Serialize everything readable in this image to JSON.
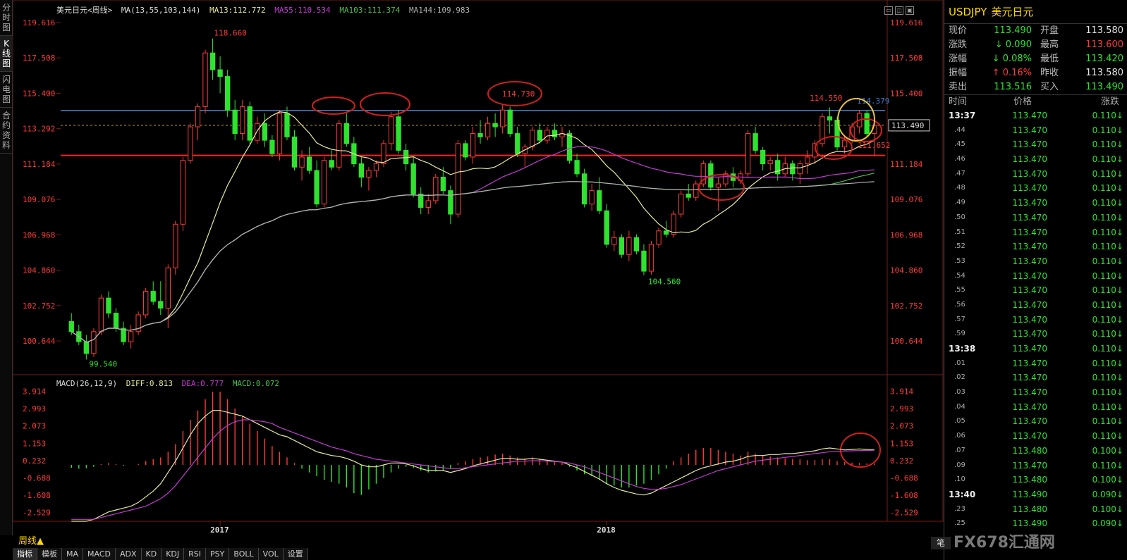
{
  "left_tabs": [
    "分时图",
    "K线图",
    "闪电图",
    "合约资料"
  ],
  "kline_header": {
    "symbol": "美元日元",
    "period": "<周线>",
    "ma_label": "MA(13,55,103,144)",
    "ma13": "MA13:112.772",
    "ma55": "MA55:110.534",
    "ma103": "MA103:111.374",
    "ma144": "MA144:109.983"
  },
  "macd_header": {
    "label": "MACD(26,12,9)",
    "diff": "DIFF:0.813",
    "dea": "DEA:0.777",
    "macd": "MACD:0.072"
  },
  "colors": {
    "up": "#ff3a3a",
    "down": "#2ee32e",
    "ma13": "#e8e8a0",
    "ma55": "#c43ad4",
    "ma103": "#4ec04e",
    "ma144": "#b0b0b0",
    "axis_label": "#ff3a3a",
    "resistance": "#3a7bd5",
    "support": "#ff2020"
  },
  "price_axis": [
    "119.616",
    "117.508",
    "115.400",
    "113.292",
    "111.184",
    "109.076",
    "106.968",
    "104.860",
    "102.752",
    "100.644"
  ],
  "macd_axis": [
    "3.914",
    "2.993",
    "2.073",
    "1.153",
    "0.232",
    "-0.688",
    "-1.608",
    "-2.529"
  ],
  "price_range": [
    98.8,
    120.2
  ],
  "macd_range": [
    -3.3,
    4.2
  ],
  "time_labels": [
    {
      "label": "2017",
      "index": 20
    },
    {
      "label": "2018",
      "index": 72
    }
  ],
  "annotations": {
    "high1": "118.660",
    "low1": "99.540",
    "circle_high": "114.730",
    "low2": "104.560",
    "high2": "114.550",
    "right_high": "114.379",
    "right_low": "111.652",
    "current_price": "113.490"
  },
  "candles": [
    [
      101.8,
      102.3,
      101.0,
      101.2
    ],
    [
      101.2,
      101.6,
      100.4,
      100.6
    ],
    [
      100.6,
      101.0,
      99.54,
      99.9
    ],
    [
      99.9,
      101.4,
      99.7,
      101.2
    ],
    [
      101.2,
      103.4,
      101.0,
      103.2
    ],
    [
      103.2,
      103.6,
      102.0,
      102.3
    ],
    [
      102.3,
      102.6,
      101.2,
      101.4
    ],
    [
      101.4,
      101.8,
      100.4,
      100.6
    ],
    [
      100.6,
      101.6,
      100.2,
      101.2
    ],
    [
      101.2,
      102.4,
      101.0,
      102.2
    ],
    [
      102.2,
      103.8,
      102.0,
      103.6
    ],
    [
      103.6,
      104.2,
      102.8,
      103.0
    ],
    [
      103.0,
      104.2,
      102.2,
      102.6
    ],
    [
      102.6,
      105.2,
      101.4,
      105.0
    ],
    [
      105.0,
      107.8,
      104.6,
      107.6
    ],
    [
      107.6,
      111.6,
      107.2,
      111.4
    ],
    [
      111.4,
      113.6,
      111.2,
      113.4
    ],
    [
      113.4,
      114.8,
      112.6,
      114.6
    ],
    [
      114.6,
      118.0,
      114.2,
      117.8
    ],
    [
      117.8,
      118.66,
      116.2,
      116.8
    ],
    [
      116.8,
      117.6,
      115.4,
      116.4
    ],
    [
      116.4,
      116.8,
      114.0,
      114.4
    ],
    [
      114.4,
      115.0,
      112.6,
      113.0
    ],
    [
      113.0,
      115.0,
      112.6,
      114.6
    ],
    [
      114.6,
      114.9,
      112.4,
      112.6
    ],
    [
      112.6,
      114.0,
      112.4,
      113.6
    ],
    [
      113.6,
      114.2,
      112.2,
      112.6
    ],
    [
      112.6,
      112.9,
      111.6,
      111.8
    ],
    [
      111.8,
      114.4,
      111.4,
      114.2
    ],
    [
      114.2,
      114.6,
      112.6,
      112.8
    ],
    [
      112.8,
      113.2,
      110.8,
      111.0
    ],
    [
      111.0,
      112.0,
      110.2,
      111.6
    ],
    [
      111.6,
      112.2,
      110.6,
      110.8
    ],
    [
      110.8,
      111.4,
      108.6,
      108.8
    ],
    [
      108.8,
      111.6,
      108.6,
      111.4
    ],
    [
      111.4,
      112.0,
      110.8,
      111.0
    ],
    [
      111.0,
      113.8,
      110.8,
      113.6
    ],
    [
      113.6,
      114.2,
      112.2,
      112.4
    ],
    [
      112.4,
      112.8,
      111.0,
      111.2
    ],
    [
      111.2,
      111.6,
      109.8,
      110.4
    ],
    [
      110.4,
      111.0,
      109.6,
      110.8
    ],
    [
      110.8,
      111.4,
      110.4,
      111.2
    ],
    [
      111.2,
      112.6,
      111.0,
      112.4
    ],
    [
      112.4,
      114.3,
      112.0,
      114.0
    ],
    [
      114.0,
      114.4,
      111.8,
      112.0
    ],
    [
      112.0,
      112.4,
      110.8,
      111.2
    ],
    [
      111.2,
      111.6,
      109.2,
      109.4
    ],
    [
      109.4,
      109.8,
      108.2,
      108.6
    ],
    [
      108.6,
      109.4,
      108.2,
      109.0
    ],
    [
      109.0,
      110.6,
      108.8,
      110.4
    ],
    [
      110.4,
      111.0,
      109.4,
      109.6
    ],
    [
      109.6,
      109.9,
      107.6,
      108.2
    ],
    [
      108.2,
      112.6,
      108.0,
      112.4
    ],
    [
      112.4,
      112.6,
      111.4,
      111.6
    ],
    [
      111.6,
      113.4,
      111.2,
      113.0
    ],
    [
      113.0,
      113.8,
      112.4,
      112.8
    ],
    [
      112.8,
      114.0,
      112.6,
      113.6
    ],
    [
      113.6,
      114.2,
      112.8,
      113.4
    ],
    [
      113.4,
      114.73,
      113.0,
      114.4
    ],
    [
      114.4,
      114.6,
      112.8,
      113.0
    ],
    [
      113.0,
      113.4,
      111.6,
      111.8
    ],
    [
      111.8,
      112.4,
      111.0,
      112.2
    ],
    [
      112.2,
      113.4,
      112.0,
      113.2
    ],
    [
      113.2,
      113.6,
      112.4,
      112.6
    ],
    [
      112.6,
      113.4,
      112.4,
      113.2
    ],
    [
      113.2,
      113.6,
      112.6,
      112.8
    ],
    [
      112.8,
      113.4,
      112.2,
      113.0
    ],
    [
      113.0,
      113.2,
      111.2,
      111.4
    ],
    [
      111.4,
      111.8,
      110.4,
      110.6
    ],
    [
      110.6,
      110.9,
      108.6,
      108.8
    ],
    [
      108.8,
      110.0,
      108.4,
      109.6
    ],
    [
      109.6,
      110.4,
      108.2,
      108.4
    ],
    [
      108.4,
      108.8,
      106.2,
      106.4
    ],
    [
      106.4,
      107.2,
      106.0,
      106.8
    ],
    [
      106.8,
      107.0,
      105.6,
      105.8
    ],
    [
      105.8,
      107.2,
      105.4,
      106.8
    ],
    [
      106.8,
      107.0,
      105.8,
      106.0
    ],
    [
      106.0,
      106.4,
      104.56,
      104.8
    ],
    [
      104.8,
      106.6,
      104.6,
      106.4
    ],
    [
      106.4,
      107.4,
      106.2,
      107.2
    ],
    [
      107.2,
      107.8,
      106.8,
      107.0
    ],
    [
      107.0,
      108.4,
      106.8,
      108.2
    ],
    [
      108.2,
      109.6,
      108.0,
      109.4
    ],
    [
      109.4,
      110.0,
      109.0,
      109.2
    ],
    [
      109.2,
      110.2,
      109.0,
      110.0
    ],
    [
      110.0,
      111.4,
      109.8,
      111.2
    ],
    [
      111.2,
      111.4,
      109.6,
      109.8
    ],
    [
      109.8,
      110.4,
      108.4,
      110.0
    ],
    [
      110.0,
      110.8,
      109.8,
      110.6
    ],
    [
      110.6,
      111.0,
      109.8,
      110.2
    ],
    [
      110.2,
      110.8,
      110.0,
      110.6
    ],
    [
      110.6,
      113.2,
      110.4,
      113.0
    ],
    [
      113.0,
      113.4,
      111.8,
      112.0
    ],
    [
      112.0,
      112.2,
      110.8,
      111.2
    ],
    [
      111.2,
      111.6,
      110.8,
      111.4
    ],
    [
      111.4,
      111.8,
      110.2,
      110.6
    ],
    [
      110.6,
      111.6,
      110.4,
      111.2
    ],
    [
      111.2,
      111.4,
      110.2,
      110.6
    ],
    [
      110.6,
      111.4,
      110.0,
      111.2
    ],
    [
      111.2,
      112.0,
      110.6,
      111.6
    ],
    [
      111.6,
      112.6,
      111.2,
      112.4
    ],
    [
      112.4,
      114.2,
      112.2,
      114.0
    ],
    [
      114.0,
      114.55,
      113.0,
      113.8
    ],
    [
      113.8,
      114.0,
      112.0,
      112.2
    ],
    [
      112.2,
      112.9,
      111.8,
      112.6
    ],
    [
      112.6,
      113.6,
      112.4,
      113.4
    ],
    [
      113.4,
      114.4,
      113.0,
      114.2
    ],
    [
      114.2,
      114.379,
      112.8,
      113.0
    ],
    [
      113.0,
      113.6,
      111.652,
      113.49
    ]
  ],
  "macd_hist": [
    -0.15,
    -0.2,
    -0.18,
    -0.1,
    0.05,
    0.1,
    0.05,
    -0.05,
    0.0,
    0.05,
    0.2,
    0.3,
    0.4,
    0.7,
    1.1,
    1.8,
    2.4,
    2.9,
    3.5,
    3.9,
    3.9,
    3.5,
    3.0,
    2.6,
    2.2,
    1.8,
    1.4,
    1.0,
    0.7,
    0.4,
    0.1,
    -0.2,
    -0.4,
    -0.6,
    -0.8,
    -0.9,
    -1.0,
    -1.2,
    -1.5,
    -1.6,
    -1.3,
    -1.0,
    -0.7,
    -0.4,
    -0.2,
    -0.1,
    -0.15,
    -0.3,
    -0.4,
    -0.35,
    -0.3,
    -0.2,
    0.1,
    0.2,
    0.3,
    0.4,
    0.45,
    0.55,
    0.6,
    0.5,
    0.4,
    0.35,
    0.4,
    0.3,
    0.25,
    0.2,
    0.15,
    -0.1,
    -0.3,
    -0.5,
    -0.6,
    -0.8,
    -1.0,
    -1.1,
    -1.2,
    -1.2,
    -1.1,
    -1.0,
    -0.8,
    -0.5,
    -0.2,
    0.2,
    0.4,
    0.6,
    0.8,
    0.9,
    0.9,
    0.8,
    0.7,
    0.6,
    0.5,
    0.7,
    0.6,
    0.5,
    0.45,
    0.4,
    0.35,
    0.3,
    0.3,
    0.25,
    0.25,
    0.3,
    0.3,
    0.2,
    0.15,
    0.12,
    0.1,
    0.08,
    0.07
  ],
  "diff_line": [
    -3.0,
    -3.0,
    -3.0,
    -2.9,
    -2.7,
    -2.5,
    -2.4,
    -2.3,
    -2.2,
    -2.0,
    -1.7,
    -1.4,
    -1.0,
    -0.4,
    0.2,
    0.9,
    1.6,
    2.2,
    2.6,
    2.9,
    2.9,
    2.8,
    2.7,
    2.6,
    2.4,
    2.2,
    2.0,
    1.8,
    1.6,
    1.5,
    1.3,
    1.1,
    0.9,
    0.7,
    0.6,
    0.5,
    0.45,
    0.35,
    0.2,
    0.0,
    -0.1,
    -0.1,
    0.0,
    0.1,
    0.1,
    0.05,
    -0.05,
    -0.2,
    -0.3,
    -0.3,
    -0.3,
    -0.4,
    -0.3,
    -0.2,
    -0.05,
    0.05,
    0.15,
    0.25,
    0.35,
    0.35,
    0.3,
    0.3,
    0.35,
    0.3,
    0.25,
    0.2,
    0.15,
    0.0,
    -0.15,
    -0.35,
    -0.55,
    -0.75,
    -1.0,
    -1.2,
    -1.35,
    -1.45,
    -1.55,
    -1.6,
    -1.5,
    -1.3,
    -1.1,
    -0.9,
    -0.7,
    -0.5,
    -0.3,
    -0.15,
    -0.05,
    0.05,
    0.15,
    0.2,
    0.3,
    0.45,
    0.5,
    0.5,
    0.55,
    0.55,
    0.6,
    0.6,
    0.65,
    0.7,
    0.75,
    0.85,
    0.9,
    0.85,
    0.8,
    0.82,
    0.85,
    0.82,
    0.813
  ],
  "dea_line": [
    -2.9,
    -2.9,
    -2.9,
    -2.9,
    -2.8,
    -2.7,
    -2.6,
    -2.5,
    -2.4,
    -2.3,
    -2.2,
    -2.0,
    -1.8,
    -1.5,
    -1.1,
    -0.6,
    -0.1,
    0.4,
    0.9,
    1.4,
    1.8,
    2.1,
    2.3,
    2.4,
    2.4,
    2.35,
    2.3,
    2.2,
    2.0,
    1.85,
    1.7,
    1.55,
    1.4,
    1.25,
    1.1,
    0.95,
    0.85,
    0.75,
    0.6,
    0.5,
    0.4,
    0.3,
    0.25,
    0.2,
    0.15,
    0.1,
    0.05,
    0.0,
    -0.05,
    -0.1,
    -0.15,
    -0.2,
    -0.2,
    -0.15,
    -0.1,
    -0.05,
    0.0,
    0.05,
    0.1,
    0.15,
    0.2,
    0.2,
    0.22,
    0.22,
    0.2,
    0.18,
    0.15,
    0.1,
    0.0,
    -0.1,
    -0.25,
    -0.4,
    -0.55,
    -0.7,
    -0.85,
    -1.0,
    -1.15,
    -1.25,
    -1.3,
    -1.3,
    -1.25,
    -1.15,
    -1.05,
    -0.9,
    -0.75,
    -0.6,
    -0.45,
    -0.3,
    -0.2,
    -0.1,
    0.0,
    0.1,
    0.2,
    0.25,
    0.3,
    0.35,
    0.4,
    0.45,
    0.5,
    0.55,
    0.6,
    0.65,
    0.7,
    0.72,
    0.74,
    0.75,
    0.76,
    0.77,
    0.777
  ],
  "quote": {
    "symbol": "USDJPY",
    "name": "美元日元",
    "rows": [
      {
        "l1": "现价",
        "v1": "113.490",
        "c1": "green",
        "l2": "开盘",
        "v2": "113.580",
        "c2": "white"
      },
      {
        "l1": "涨跌",
        "v1": "↓ 0.090",
        "c1": "green",
        "l2": "最高",
        "v2": "113.600",
        "c2": "red"
      },
      {
        "l1": "涨幅",
        "v1": "↓ 0.08%",
        "c1": "green",
        "l2": "最低",
        "v2": "113.420",
        "c2": "green"
      },
      {
        "l1": "振幅",
        "v1": "↑ 0.16%",
        "c1": "red",
        "l2": "昨收",
        "v2": "113.580",
        "c2": "white"
      },
      {
        "l1": "卖出",
        "v1": "113.516",
        "c1": "green",
        "l2": "买入",
        "v2": "113.490",
        "c2": "green"
      }
    ],
    "table_headers": [
      "时间",
      "价格",
      "涨跌"
    ],
    "ticks": [
      {
        "t": "13:37",
        "major": true,
        "p": "113.470",
        "c": "0.110↓"
      },
      {
        "t": ".44",
        "p": "113.470",
        "c": "0.110↓"
      },
      {
        "t": ".45",
        "p": "113.470",
        "c": "0.110↓"
      },
      {
        "t": ".46",
        "p": "113.470",
        "c": "0.110↓"
      },
      {
        "t": ".47",
        "p": "113.470",
        "c": "0.110↓"
      },
      {
        "t": ".48",
        "p": "113.470",
        "c": "0.110↓"
      },
      {
        "t": ".49",
        "p": "113.470",
        "c": "0.110↓"
      },
      {
        "t": ".50",
        "p": "113.470",
        "c": "0.110↓"
      },
      {
        "t": ".51",
        "p": "113.470",
        "c": "0.110↓"
      },
      {
        "t": ".52",
        "p": "113.470",
        "c": "0.110↓"
      },
      {
        "t": ".53",
        "p": "113.470",
        "c": "0.110↓"
      },
      {
        "t": ".54",
        "p": "113.470",
        "c": "0.110↓"
      },
      {
        "t": ".55",
        "p": "113.470",
        "c": "0.110↓"
      },
      {
        "t": ".56",
        "p": "113.470",
        "c": "0.110↓"
      },
      {
        "t": ".57",
        "p": "113.470",
        "c": "0.110↓"
      },
      {
        "t": ".59",
        "p": "113.470",
        "c": "0.110↓"
      },
      {
        "t": "13:38",
        "major": true,
        "p": "113.470",
        "c": "0.110↓"
      },
      {
        "t": ".01",
        "p": "113.470",
        "c": "0.110↓"
      },
      {
        "t": ".02",
        "p": "113.470",
        "c": "0.110↓"
      },
      {
        "t": ".03",
        "p": "113.470",
        "c": "0.110↓"
      },
      {
        "t": ".04",
        "p": "113.470",
        "c": "0.110↓"
      },
      {
        "t": ".05",
        "p": "113.470",
        "c": "0.110↓"
      },
      {
        "t": ".06",
        "p": "113.470",
        "c": "0.110↓"
      },
      {
        "t": ".07",
        "p": "113.480",
        "c": "0.100↓"
      },
      {
        "t": ".09",
        "p": "113.470",
        "c": "0.110↓"
      },
      {
        "t": ".10",
        "p": "113.480",
        "c": "0.100↓"
      },
      {
        "t": "13:40",
        "major": true,
        "p": "113.490",
        "c": "0.090↓"
      },
      {
        "t": ".23",
        "p": "113.480",
        "c": "0.100↓"
      },
      {
        "t": ".25",
        "p": "113.490",
        "c": "0.090↓"
      }
    ]
  },
  "bottom": {
    "period_label": "周线▲",
    "tabs": [
      "指标",
      "模板",
      "MA",
      "MACD",
      "ADX",
      "KD",
      "KDJ",
      "RSI",
      "PSY",
      "BOLL",
      "VOL",
      "设置"
    ],
    "pen": "笔",
    "watermark": "FX678汇通网"
  }
}
